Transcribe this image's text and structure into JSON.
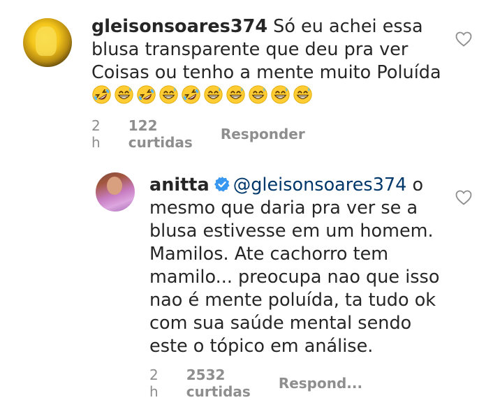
{
  "comments": [
    {
      "username": "gleisonsoares374",
      "text_lines": [
        " Só eu achei essa",
        "blusa transparente que deu pra ver",
        "Coisas ou tenho a mente muito Poluída"
      ],
      "emojis": [
        "rofl",
        "grin-sweat",
        "rofl",
        "grin-sweat",
        "rofl",
        "grin-sweat",
        "grin-sweat",
        "grin-sweat",
        "grin-sweat",
        "grin-sweat"
      ],
      "time": "2 h",
      "likes": "122 curtidas",
      "reply": "Responder"
    },
    {
      "username": "anitta",
      "verified": true,
      "mention": "@gleisonsoares374",
      "first_line_rest": " o",
      "text_lines": [
        "mesmo que daria pra ver se a",
        "blusa estivesse em um homem.",
        "Mamilos. Ate cachorro tem",
        "mamilo... preocupa nao que isso",
        "nao é mente poluída, ta tudo ok",
        "com sua saúde mental sendo",
        "este o tópico em análise."
      ],
      "time": "2 h",
      "likes": "2532 curtidas",
      "reply": "Respond..."
    }
  ],
  "colors": {
    "text": "#262626",
    "meta": "#8e8e8e",
    "mention": "#00376b",
    "verified": "#3897f0"
  },
  "icons": {
    "like": "heart-outline-icon",
    "verified": "verified-badge-icon"
  }
}
